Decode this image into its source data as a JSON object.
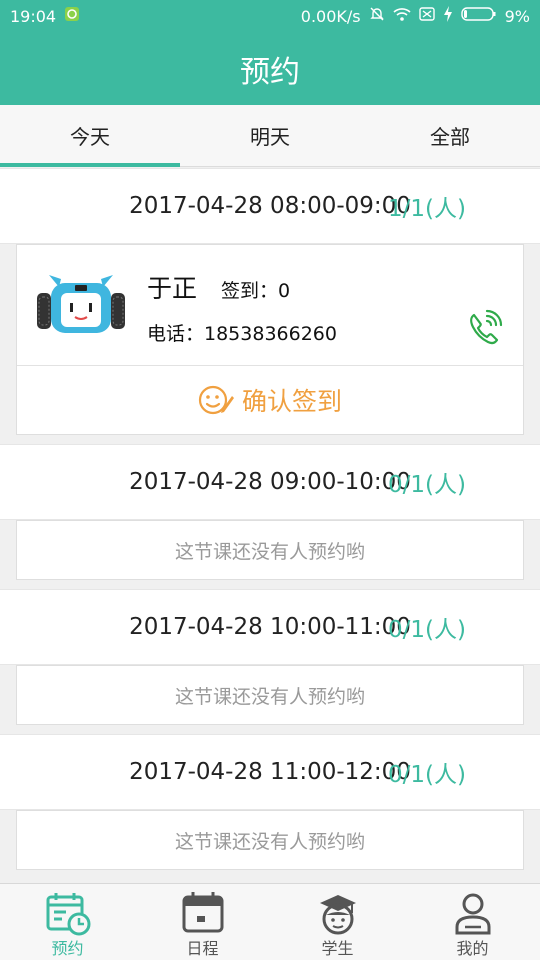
{
  "status_bar": {
    "time": "19:04",
    "network_speed": "0.00K/s",
    "battery": "9%"
  },
  "app_bar": {
    "title": "预约"
  },
  "tabs": [
    {
      "label": "今天",
      "active": true
    },
    {
      "label": "明天",
      "active": false
    },
    {
      "label": "全部",
      "active": false
    }
  ],
  "slots": [
    {
      "time": "2017-04-28 08:00-09:00",
      "count": "1/1(人)",
      "booking": {
        "name": "于正",
        "checkin": "签到：0",
        "phone": "电话：18538366260",
        "confirm_label": "确认签到"
      }
    },
    {
      "time": "2017-04-28 09:00-10:00",
      "count": "0/1(人)",
      "empty_text": "这节课还没有人预约哟"
    },
    {
      "time": "2017-04-28 10:00-11:00",
      "count": "0/1(人)",
      "empty_text": "这节课还没有人预约哟"
    },
    {
      "time": "2017-04-28 11:00-12:00",
      "count": "0/1(人)",
      "empty_text": "这节课还没有人预约哟"
    }
  ],
  "bottom_nav": [
    {
      "label": "预约",
      "icon": "calendar-clock-icon",
      "active": true
    },
    {
      "label": "日程",
      "icon": "calendar-icon",
      "active": false
    },
    {
      "label": "学生",
      "icon": "student-icon",
      "active": false
    },
    {
      "label": "我的",
      "icon": "person-icon",
      "active": false
    }
  ],
  "colors": {
    "primary": "#3dbaa0",
    "accent_orange": "#f0a040",
    "call_green": "#2faa4a"
  }
}
